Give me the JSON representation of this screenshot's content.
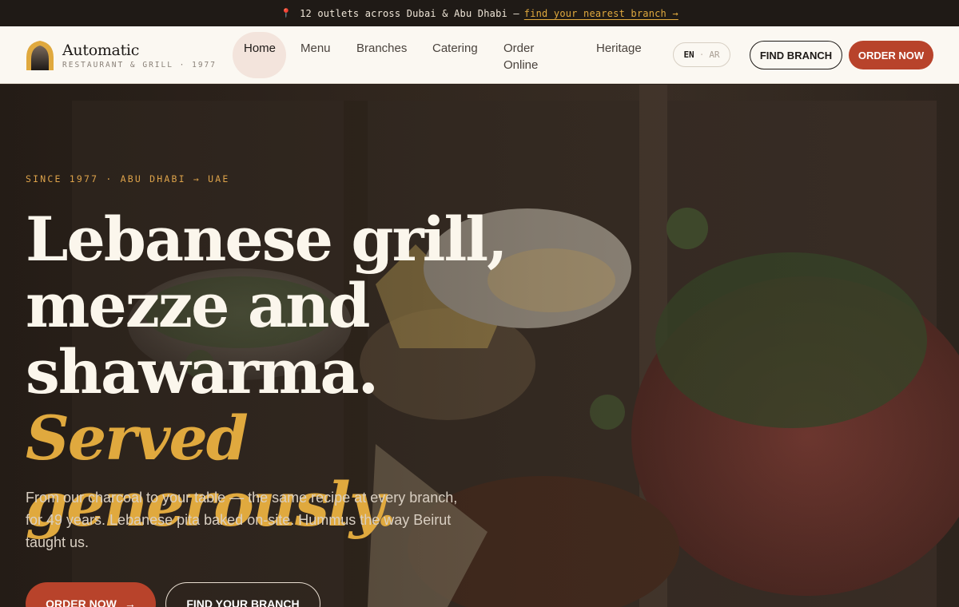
{
  "announcement": {
    "text": "12 outlets across Dubai & Abu Dhabi —",
    "link": "find your nearest branch →"
  },
  "brand": {
    "name": "Automatic",
    "tagline": "RESTAURANT & GRILL · 1977"
  },
  "nav": {
    "items": [
      {
        "label": "Home"
      },
      {
        "label": "Menu"
      },
      {
        "label": "Branches"
      },
      {
        "label": "Catering"
      },
      {
        "label": "Order Online"
      },
      {
        "label": "Heritage"
      }
    ]
  },
  "lang": {
    "en": "EN",
    "sep": "·",
    "ar": "AR"
  },
  "header_actions": {
    "find_branch": "FIND BRANCH",
    "order_now": "ORDER NOW"
  },
  "hero": {
    "eyebrow": "SINCE 1977 · ABU DHABI → UAE",
    "headline_line1": "Lebanese grill,",
    "headline_line2": "mezze and",
    "headline_line3": "shawarma.",
    "headline_accent": "Served generously.",
    "lead": "From our charcoal to your table — the same recipe at every branch, for 49 years. Lebanese pita baked on-site. Hummus the way Beirut taught us.",
    "cta_primary": "ORDER NOW",
    "cta_primary_icon": "→",
    "cta_secondary": "FIND YOUR BRANCH"
  },
  "colors": {
    "accent": "#b8432b",
    "gold": "#e0a93e",
    "dark": "#1f1a16",
    "cream": "#fbf8f2"
  }
}
